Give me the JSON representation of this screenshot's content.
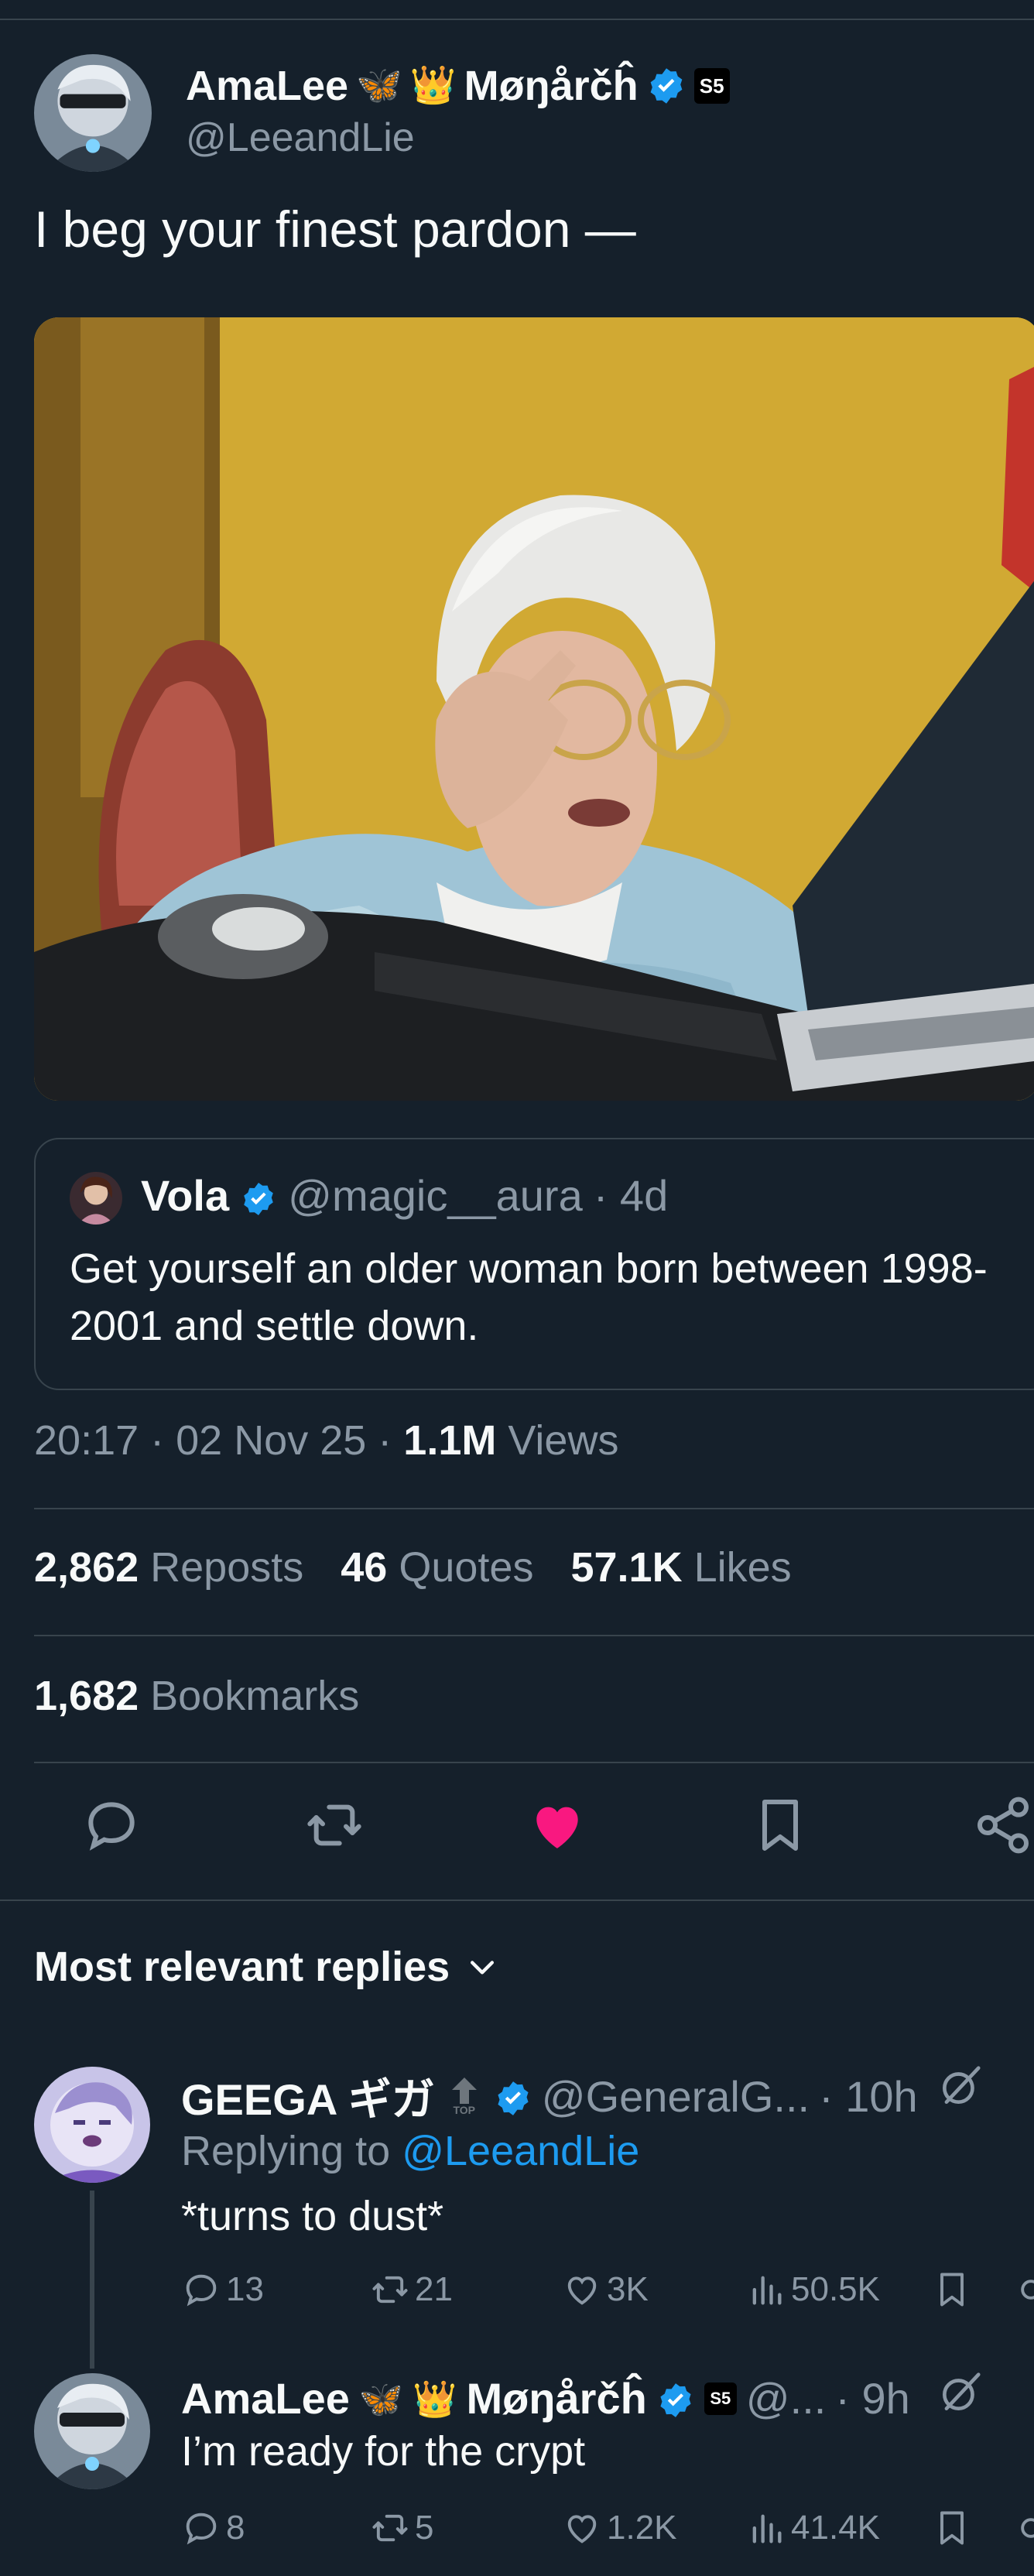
{
  "tweet": {
    "author_name": "AmaLee",
    "author_name_suffix": "Møŋårčĥ",
    "butterfly_emoji": "🦋",
    "crown_emoji": "👑",
    "affiliate_badge": "S5",
    "handle": "@LeeandLie",
    "text": "I beg your finest pardon —",
    "timestamp": "20:17 · 02 Nov 25 ·",
    "views_count": "1.1M",
    "views_label": "Views"
  },
  "quote": {
    "name": "Vola",
    "handle": "@magic__aura",
    "time": "· 4d",
    "text": "Get yourself an older woman born between 1998-2001 and settle down."
  },
  "stats": {
    "reposts_count": "2,862",
    "reposts_label": "Reposts",
    "quotes_count": "46",
    "quotes_label": "Quotes",
    "likes_count": "57.1K",
    "likes_label": "Likes",
    "bookmarks_count": "1,682",
    "bookmarks_label": "Bookmarks"
  },
  "action_icons": [
    "reply-icon",
    "repost-icon",
    "like-icon-filled",
    "bookmark-icon",
    "share-icon"
  ],
  "replies_header": "Most relevant replies",
  "replies": [
    {
      "name": "GEEGA ギガ",
      "top_badge": "TOP",
      "handle": "@GeneralG...",
      "time": "· 10h",
      "replying_prefix": "Replying to",
      "replying_to": "@LeeandLie",
      "text": "*turns to dust*",
      "replies": "13",
      "reposts": "21",
      "likes": "3K",
      "views": "50.5K"
    },
    {
      "name": "AmaLee",
      "name_suffix": "Møŋårčĥ",
      "affiliate_badge": "S5",
      "handle": "@...",
      "time": "· 9h",
      "text": "I’m ready for the crypt",
      "replies": "8",
      "reposts": "5",
      "likes": "1.2K",
      "views": "41.4K"
    }
  ],
  "colors": {
    "background": "#15202b",
    "text": "#f7f9f9",
    "secondary": "#8b98a5",
    "link": "#1d9bf0",
    "like": "#f91880",
    "divider": "#38444d"
  }
}
